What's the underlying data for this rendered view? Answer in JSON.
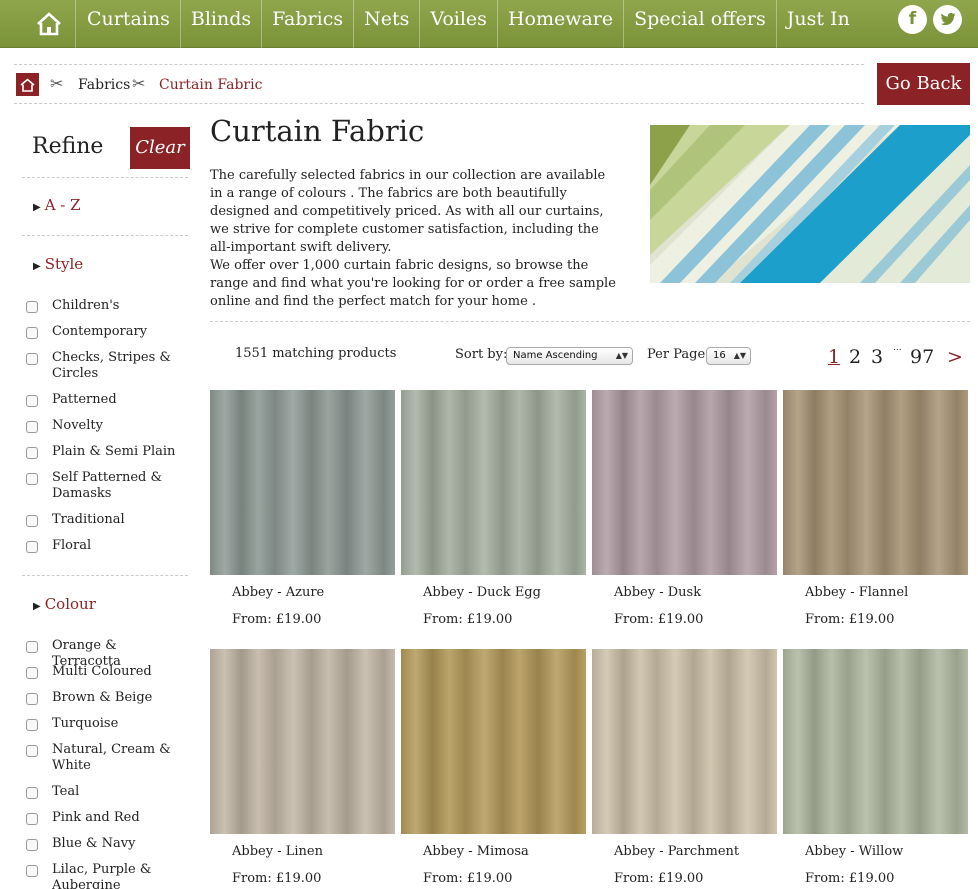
{
  "nav": {
    "items": [
      "Curtains",
      "Blinds",
      "Fabrics",
      "Nets",
      "Voiles",
      "Homeware",
      "Special offers",
      "Just In"
    ],
    "social": [
      "f",
      "t"
    ]
  },
  "breadcrumb": {
    "items": [
      "Fabrics",
      "Curtain Fabric"
    ],
    "go_back": "Go Back"
  },
  "sidebar": {
    "refine": "Refine",
    "clear": "Clear",
    "facets": [
      "A - Z",
      "Style",
      "Colour"
    ],
    "style_options": [
      "Children's",
      "Contemporary",
      "Checks, Stripes & Circles",
      "Patterned",
      "Novelty",
      "Plain & Semi Plain",
      "Self Patterned & Damasks",
      "Traditional",
      "Floral"
    ],
    "colour_options": [
      "Orange & Terracotta",
      "Multi Coloured",
      "Brown & Beige",
      "Turquoise",
      "Natural, Cream & White",
      "Teal",
      "Pink and Red",
      "Blue & Navy",
      "Lilac, Purple & Aubergine"
    ]
  },
  "main": {
    "title": "Curtain Fabric",
    "description_1": "The carefully selected fabrics in our collection are available in a range of colours . The fabrics are both beautifully designed and competitively priced. As with all our curtains, we strive for complete customer satisfaction, including the all-important swift delivery.",
    "description_2": "We offer over 1,000 curtain fabric designs, so browse the range and find what you're looking for or order a free sample online and find the perfect match for your home ."
  },
  "toolbar": {
    "count": "1551 matching products",
    "sort_label": "Sort by:",
    "sort_value": "Name Ascending",
    "per_page_label": "Per Page:",
    "per_page_value": "16",
    "pages": [
      "1",
      "2",
      "3",
      "...",
      "97",
      ">"
    ]
  },
  "products": [
    {
      "name": "Abbey - Azure",
      "price": "From: £19.00",
      "color": "#8f9a95"
    },
    {
      "name": "Abbey - Duck Egg",
      "price": "From: £19.00",
      "color": "#a5b0a0"
    },
    {
      "name": "Abbey - Dusk",
      "price": "From: £19.00",
      "color": "#b09da3"
    },
    {
      "name": "Abbey - Flannel",
      "price": "From: £19.00",
      "color": "#a89476"
    },
    {
      "name": "Abbey - Linen",
      "price": "From: £19.00",
      "color": "#c2b6a6"
    },
    {
      "name": "Abbey - Mimosa",
      "price": "From: £19.00",
      "color": "#b49a5a"
    },
    {
      "name": "Abbey - Parchment",
      "price": "From: £19.00",
      "color": "#cdc1a9"
    },
    {
      "name": "Abbey - Willow",
      "price": "From: £19.00",
      "color": "#afb7a0"
    }
  ],
  "colors": {
    "nav": "#7f973d",
    "accent": "#8b2326"
  }
}
